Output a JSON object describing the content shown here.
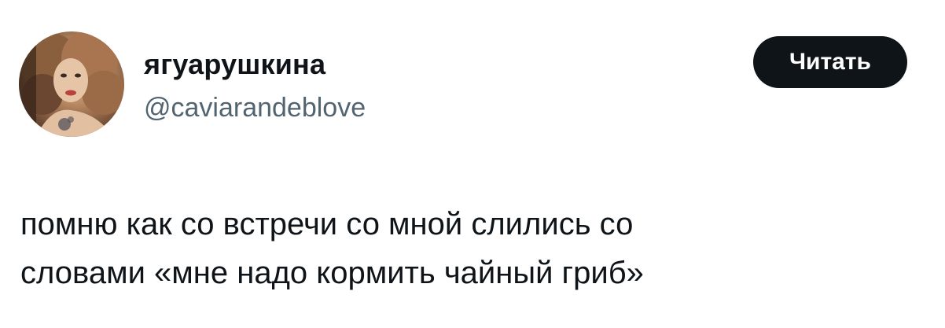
{
  "author": {
    "display_name": "ягуарушкина",
    "handle": "@caviarandeblove",
    "avatar_icon": "user-avatar-photo"
  },
  "actions": {
    "follow_label": "Читать"
  },
  "tweet": {
    "text": "помню как со встречи со мной слились со\nсловами «мне надо кормить чайный гриб»"
  },
  "colors": {
    "text_primary": "#0f1419",
    "text_secondary": "#536471",
    "button_bg": "#0f1419",
    "button_text": "#ffffff",
    "background": "#ffffff"
  }
}
